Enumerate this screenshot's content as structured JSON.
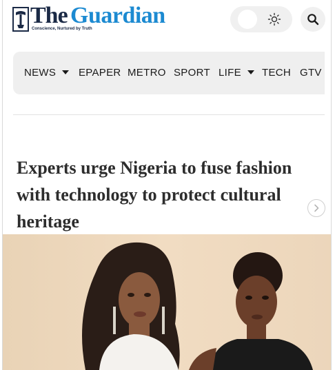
{
  "header": {
    "logo_the": "The",
    "logo_guardian": "Guardian",
    "logo_tagline": "Conscience, Nurtured by Truth",
    "theme_toggle_icon": "sun-icon",
    "search_icon": "search-icon"
  },
  "nav": {
    "items": [
      {
        "label": "NEWS",
        "has_dropdown": true
      },
      {
        "label": "EPAPER",
        "has_dropdown": false
      },
      {
        "label": "METRO",
        "has_dropdown": false
      },
      {
        "label": "SPORT",
        "has_dropdown": false
      },
      {
        "label": "LIFE",
        "has_dropdown": true
      },
      {
        "label": "TECH",
        "has_dropdown": false
      },
      {
        "label": "GTV",
        "has_dropdown": false
      }
    ]
  },
  "article": {
    "headline": "Experts urge Nigeria to fuse fashion with technology to protect cultural heritage",
    "next_icon": "chevron-right-icon"
  },
  "colors": {
    "brand_dark": "#1b2a46",
    "brand_blue": "#1c8ad1",
    "nav_bg": "#efefef",
    "headline": "#2d2d2d"
  }
}
